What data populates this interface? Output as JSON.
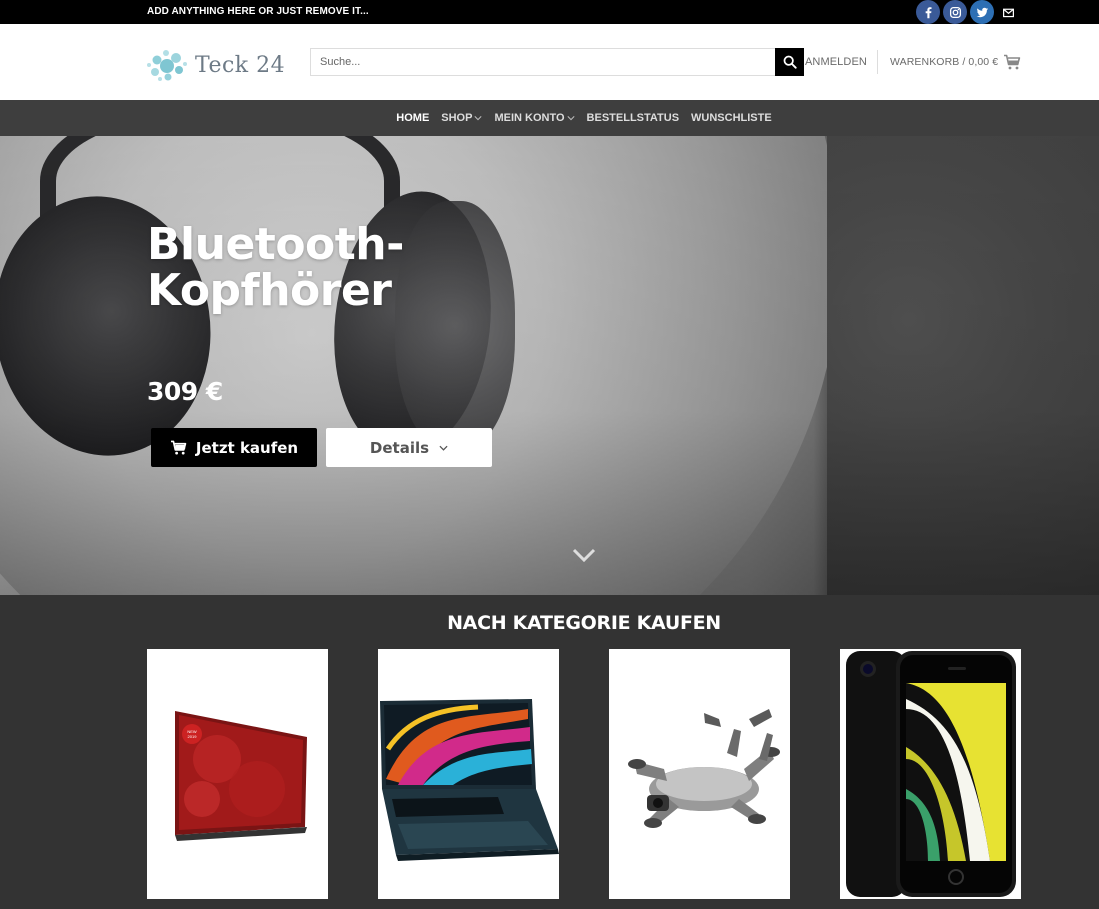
{
  "topbar": {
    "message": "ADD ANYTHING HERE OR JUST REMOVE IT..."
  },
  "social": [
    "facebook-icon",
    "instagram-icon",
    "twitter-icon",
    "mail-icon"
  ],
  "header": {
    "logo_text": "Teck 24",
    "search_placeholder": "Suche...",
    "login_label": "ANMELDEN",
    "cart_label": "WARENKORB / 0,00 €"
  },
  "nav": {
    "items": [
      {
        "label": "HOME",
        "dropdown": false,
        "active": true
      },
      {
        "label": "SHOP",
        "dropdown": true,
        "active": false
      },
      {
        "label": "MEIN KONTO",
        "dropdown": true,
        "active": false
      },
      {
        "label": "BESTELLSTATUS",
        "dropdown": false,
        "active": false
      },
      {
        "label": "WUNSCHLISTE",
        "dropdown": false,
        "active": false
      }
    ]
  },
  "hero": {
    "title_line1": "Bluetooth-",
    "title_line2": "Kopfhörer",
    "price": "309 €",
    "buy_label": "Jetzt kaufen",
    "details_label": "Details"
  },
  "categories": {
    "title": "NACH KATEGORIE KAUFEN",
    "items": [
      "tv-image",
      "laptop-image",
      "drone-image",
      "smartphone-image"
    ]
  },
  "colors": {
    "accent": "#000000",
    "nav_bg": "#3e3e3e",
    "section_bg": "#333333",
    "social": "#3a5a98"
  }
}
